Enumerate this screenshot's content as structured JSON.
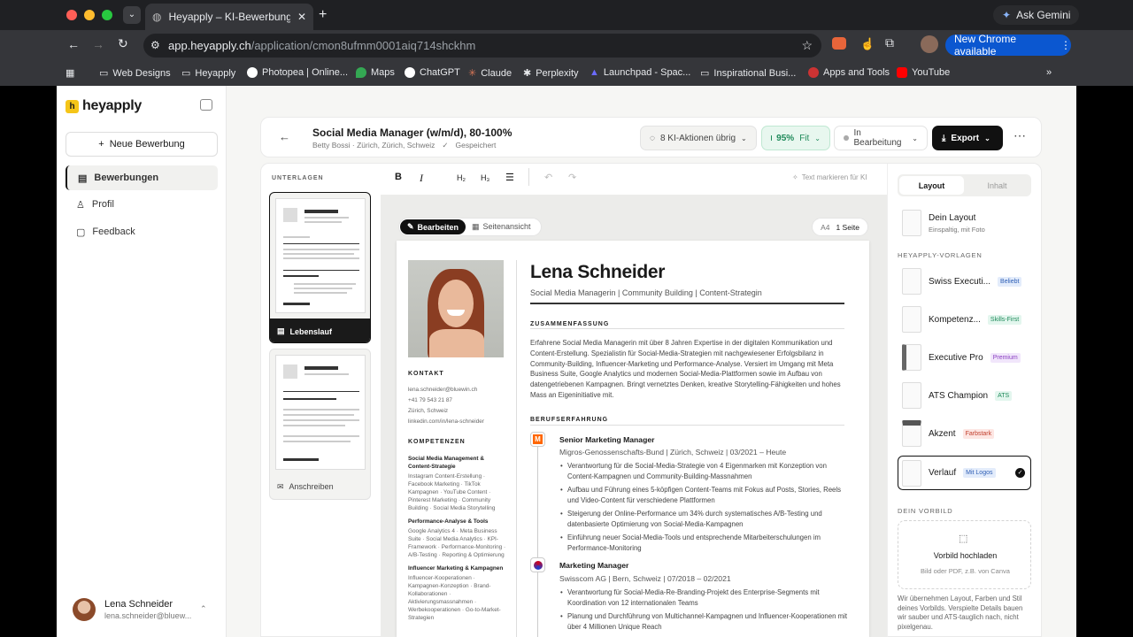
{
  "browser": {
    "tab_title": "Heyapply – KI-Bewerbungstool",
    "url_host": "app.heyapply.ch",
    "url_path": "/application/cmon8ufmm0001aiq714shckhm",
    "ask_gemini": "Ask Gemini",
    "new_chrome": "New Chrome available",
    "bookmarks": [
      "Web Designs",
      "Heyapply",
      "Photopea | Online...",
      "Maps",
      "ChatGPT",
      "Claude",
      "Perplexity",
      "Launchpad - Spac...",
      "Inspirational Busi...",
      "Apps and Tools",
      "YouTube"
    ]
  },
  "sidebar": {
    "logo": "heyapply",
    "new_button": "Neue Bewerbung",
    "items": [
      "Bewerbungen",
      "Profil",
      "Feedback"
    ],
    "user_name": "Lena Schneider",
    "user_email": "lena.schneider@bluew..."
  },
  "header": {
    "title": "Social Media Manager (w/m/d), 80-100%",
    "subtitle": "Betty Bossi · Zürich, Zürich, Schweiz",
    "saved": "Gespeichert",
    "ai_actions": "8 KI-Aktionen übrig",
    "fit_value": "95%",
    "fit_label": "Fit",
    "status": "In Bearbeitung",
    "export": "Export"
  },
  "docs": {
    "heading": "UNTERLAGEN",
    "cv": "Lebenslauf",
    "letter": "Anschreiben"
  },
  "editor": {
    "hint": "Text markieren für KI",
    "edit": "Bearbeiten",
    "page_view": "Seitenansicht",
    "paper": "A4",
    "pages": "1 Seite"
  },
  "cv": {
    "name": "Lena Schneider",
    "tagline": "Social Media Managerin | Community Building | Content-Strategin",
    "summary_h": "ZUSAMMENFASSUNG",
    "summary": "Erfahrene Social Media Managerin mit über 8 Jahren Expertise in der digitalen Kommunikation und Content-Erstellung. Spezialistin für Social-Media-Strategien mit nachgewiesener Erfolgsbilanz in Community-Building, Influencer-Marketing und Performance-Analyse. Versiert im Umgang mit Meta Business Suite, Google Analytics und modernen Social-Media-Plattformen sowie im Aufbau von datengetriebenen Kampagnen. Bringt vernetztes Denken, kreative Storytelling-Fähigkeiten und hohes Mass an Eigeninitiative mit.",
    "exp_h": "BERUFSERFAHRUNG",
    "job1_title": "Senior Marketing Manager",
    "job1_meta": "Migros-Genossenschafts-Bund | Zürich, Schweiz | 03/2021 – Heute",
    "job1_bullets": [
      "Verantwortung für die Social-Media-Strategie von 4 Eigenmarken mit Konzeption von Content-Kampagnen und Community-Building-Massnahmen",
      "Aufbau und Führung eines 5-köpfigen Content-Teams mit Fokus auf Posts, Stories, Reels und Video-Content für verschiedene Plattformen",
      "Steigerung der Online-Performance um 34% durch systematisches A/B-Testing und datenbasierte Optimierung von Social-Media-Kampagnen",
      "Einführung neuer Social-Media-Tools und entsprechende Mitarbeiterschulungen im Performance-Monitoring"
    ],
    "job2_title": "Marketing Manager",
    "job2_meta": "Swisscom AG | Bern, Schweiz | 07/2018 – 02/2021",
    "job2_bullets": [
      "Verantwortung für Social-Media-Re-Branding-Projekt des Enterprise-Segments mit Koordination von 12 internationalen Teams",
      "Planung und Durchführung von Multichannel-Kampagnen und Influencer-Kooperationen mit über 4 Millionen Unique Reach"
    ],
    "contact_h": "KONTAKT",
    "contact": [
      "lena.schneider@bluewin.ch",
      "+41 79 543 21 87",
      "Zürich, Schweiz",
      "linkedin.com/in/lena-schneider"
    ],
    "skills_h": "KOMPETENZEN",
    "skill1_h": "Social Media Management & Content-Strategie",
    "skill1": "Instagram Content-Erstellung · Facebook Marketing · TikTok Kampagnen · YouTube Content · Pinterest Marketing · Community Building · Social Media Storytelling",
    "skill2_h": "Performance-Analyse & Tools",
    "skill2": "Google Analytics 4 · Meta Business Suite · Social Media Analytics · KPI-Framework · Performance-Monitoring · A/B-Testing · Reporting & Optimierung",
    "skill3_h": "Influencer Marketing & Kampagnen",
    "skill3": "Influencer-Kooperationen · Kampagnen-Konzeption · Brand-Kollaborationen · Aktivierungsmassnahmen · Werbekooperationen · Go-to-Market-Strategien"
  },
  "right": {
    "tab_layout": "Layout",
    "tab_content": "Inhalt",
    "own_title": "Dein Layout",
    "own_sub": "Einspaltig, mit Foto",
    "tpl_h": "HEYAPPLY-VORLAGEN",
    "templates": [
      {
        "name": "Swiss Executi...",
        "badge": "Beliebt",
        "bg": "#e3ecfb",
        "fg": "#2f5fb5"
      },
      {
        "name": "Kompetenz...",
        "badge": "Skills-First",
        "bg": "#e3f6ee",
        "fg": "#1f8a5a"
      },
      {
        "name": "Executive Pro",
        "badge": "Premium",
        "bg": "#f1e6fb",
        "fg": "#8a3fc1"
      },
      {
        "name": "ATS Champion",
        "badge": "ATS",
        "bg": "#e3f6ee",
        "fg": "#1f8a5a"
      },
      {
        "name": "Akzent",
        "badge": "Farbstark",
        "bg": "#fde6e3",
        "fg": "#c2412f"
      },
      {
        "name": "Verlauf",
        "badge": "Mit Logos",
        "bg": "#e3ecfb",
        "fg": "#2f5fb5"
      }
    ],
    "model_h": "DEIN VORBILD",
    "upload_t": "Vorbild hochladen",
    "upload_s": "Bild oder PDF, z.B. von Canva",
    "note": "Wir übernehmen Layout, Farben und Stil deines Vorbilds. Verspielte Details bauen wir sauber und ATS-tauglich nach, nicht pixelgenau."
  },
  "colors": {
    "accent": "#f5c518",
    "dark": "#111111",
    "fit_green": "#1f8a5a"
  }
}
